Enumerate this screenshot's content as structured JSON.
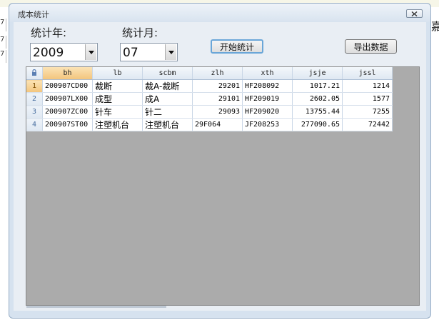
{
  "window": {
    "title": "成本统计"
  },
  "controls": {
    "year_label": "统计年:",
    "year_value": "2009",
    "month_label": "统计月:",
    "month_value": "07",
    "start_button": "开始统计",
    "export_button": "导出数据"
  },
  "background": {
    "right_char": "嘉",
    "left_digits": [
      "7",
      "7",
      "7"
    ]
  },
  "table": {
    "columns": [
      "bh",
      "lb",
      "scbm",
      "zlh",
      "xth",
      "jsje",
      "jssl"
    ],
    "rows": [
      {
        "n": "1",
        "bh": "200907CD00",
        "lb": "裁断",
        "scbm": "裁A-裁断",
        "zlh": "29201",
        "xth": "HF208092",
        "jsje": "1017.21",
        "jssl": "1214"
      },
      {
        "n": "2",
        "bh": "200907LX00",
        "lb": "成型",
        "scbm": "成A",
        "zlh": "29101",
        "xth": "HF209019",
        "jsje": "2602.05",
        "jssl": "1577"
      },
      {
        "n": "3",
        "bh": "200907ZC00",
        "lb": "针车",
        "scbm": "针二",
        "zlh": "29093",
        "xth": "HF209020",
        "jsje": "13755.44",
        "jssl": "7255"
      },
      {
        "n": "4",
        "bh": "200907ST00",
        "lb": "注塑机台",
        "scbm": "注塑机台",
        "zlh": "29F064",
        "xth": "JF208253",
        "jsje": "277090.65",
        "jssl": "72442"
      }
    ]
  }
}
